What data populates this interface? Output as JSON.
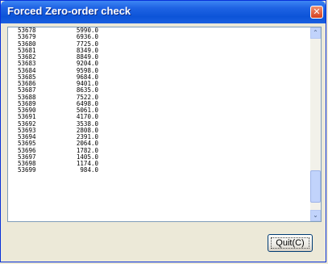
{
  "window": {
    "title": "Forced Zero-order check"
  },
  "close_glyph": "✕",
  "list": {
    "rows": [
      {
        "id": "53678",
        "value": "5990.0"
      },
      {
        "id": "53679",
        "value": "6936.0"
      },
      {
        "id": "53680",
        "value": "7725.0"
      },
      {
        "id": "53681",
        "value": "8349.0"
      },
      {
        "id": "53682",
        "value": "8849.0"
      },
      {
        "id": "53683",
        "value": "9204.0"
      },
      {
        "id": "53684",
        "value": "9598.0"
      },
      {
        "id": "53685",
        "value": "9684.0"
      },
      {
        "id": "53686",
        "value": "9401.0"
      },
      {
        "id": "53687",
        "value": "8635.0"
      },
      {
        "id": "53688",
        "value": "7522.0"
      },
      {
        "id": "53689",
        "value": "6498.0"
      },
      {
        "id": "53690",
        "value": "5061.0"
      },
      {
        "id": "53691",
        "value": "4170.0"
      },
      {
        "id": "53692",
        "value": "3538.0"
      },
      {
        "id": "53693",
        "value": "2808.0"
      },
      {
        "id": "53694",
        "value": "2391.0"
      },
      {
        "id": "53695",
        "value": "2064.0"
      },
      {
        "id": "53696",
        "value": "1782.0"
      },
      {
        "id": "53697",
        "value": "1405.0"
      },
      {
        "id": "53698",
        "value": "1174.0"
      },
      {
        "id": "53699",
        "value": "984.0"
      }
    ]
  },
  "scrollbar": {
    "up_glyph": "⌃",
    "down_glyph": "⌄",
    "position_fraction": 0.95
  },
  "buttons": {
    "quit_label": "Quit(C)"
  }
}
